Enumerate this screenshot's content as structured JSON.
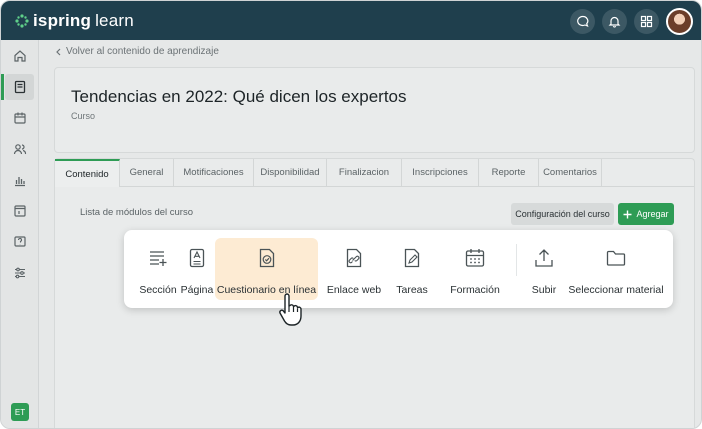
{
  "brand": {
    "name_bold": "ispring",
    "name_light": "learn"
  },
  "topbar": {
    "icons": [
      "chat-icon",
      "bell-icon",
      "apps-grid-icon"
    ],
    "avatar": "user-avatar"
  },
  "sidebar": {
    "items": [
      "home-icon",
      "courses-icon",
      "calendar-icon",
      "users-icon",
      "reports-icon",
      "catalog-icon",
      "help-icon",
      "settings-icon"
    ],
    "user_initials": "ET"
  },
  "back_link": "Volver al contenido de aprendizaje",
  "course": {
    "title": "Tendencias en 2022: Qué dicen los expertos",
    "type": "Curso"
  },
  "tabs": [
    "Contenido",
    "General",
    "Motificaciones",
    "Disponibilidad",
    "Finalizacion",
    "Inscripciones",
    "Reporte",
    "Comentarios"
  ],
  "active_tab": "Contenido",
  "modules": {
    "label": "Lista de módulos del curso",
    "config_button": "Configuración del curso",
    "add_button": "Agregar"
  },
  "add_menu": {
    "items": [
      {
        "label": "Sección",
        "icon": "section-icon"
      },
      {
        "label": "Página",
        "icon": "page-icon"
      },
      {
        "label": "Cuestionario en línea",
        "icon": "quiz-icon",
        "highlighted": true
      },
      {
        "label": "Enlace web",
        "icon": "link-icon"
      },
      {
        "label": "Tareas",
        "icon": "task-icon"
      },
      {
        "label": "Formación",
        "icon": "training-calendar-icon"
      },
      {
        "label": "Subir",
        "icon": "upload-icon"
      },
      {
        "label": "Seleccionar material",
        "icon": "folder-icon"
      }
    ]
  },
  "colors": {
    "topbar": "#1f3f4d",
    "accent": "#2e9c55",
    "highlight": "#fdebd3"
  }
}
